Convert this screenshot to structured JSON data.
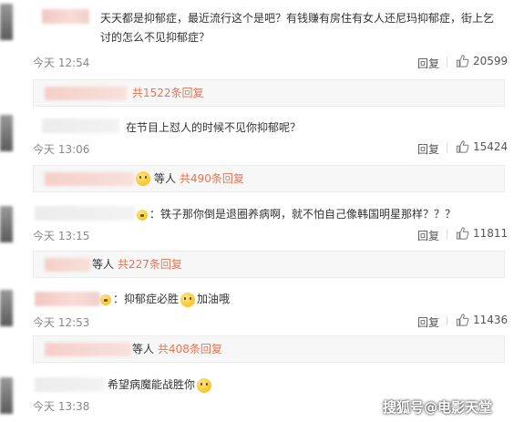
{
  "comments": [
    {
      "text": "天天都是抑郁症，最近流行这个是吧？有钱赚有房住有女人还尼玛抑郁症，街上乞讨的怎么不见抑郁症？",
      "time": "今天 12:54",
      "reply_label": "回复",
      "likes": "20599",
      "replies_summary": "共1522条回复"
    },
    {
      "text": "在节目上怼人的时候不见你抑郁呢？",
      "time": "今天 13:06",
      "reply_label": "回复",
      "likes": "15424",
      "replies_who": "等人",
      "replies_summary": "共490条回复"
    },
    {
      "text": "：铁子那你倒是退圈养病啊，就不怕自己像韩国明星那样？？？",
      "time": "今天 13:15",
      "reply_label": "回复",
      "likes": "11811",
      "replies_who": "等人",
      "replies_summary": "共227条回复"
    },
    {
      "text_before": "：抑郁症必胜",
      "text_after": "加油哦",
      "time": "今天 12:53",
      "reply_label": "回复",
      "likes": "11436",
      "replies_who": "等人",
      "replies_summary": "共408条回复"
    },
    {
      "text": "希望病魔能战胜你",
      "time": "今天 13:38"
    }
  ],
  "watermark": "搜狐号@电影天堂",
  "colors": {
    "accent": "#eb7350",
    "muted": "#888888"
  },
  "icons": {
    "like": "thumbs-up-icon",
    "time": "clock-icon",
    "emoji": "smile-emoji-icon"
  }
}
